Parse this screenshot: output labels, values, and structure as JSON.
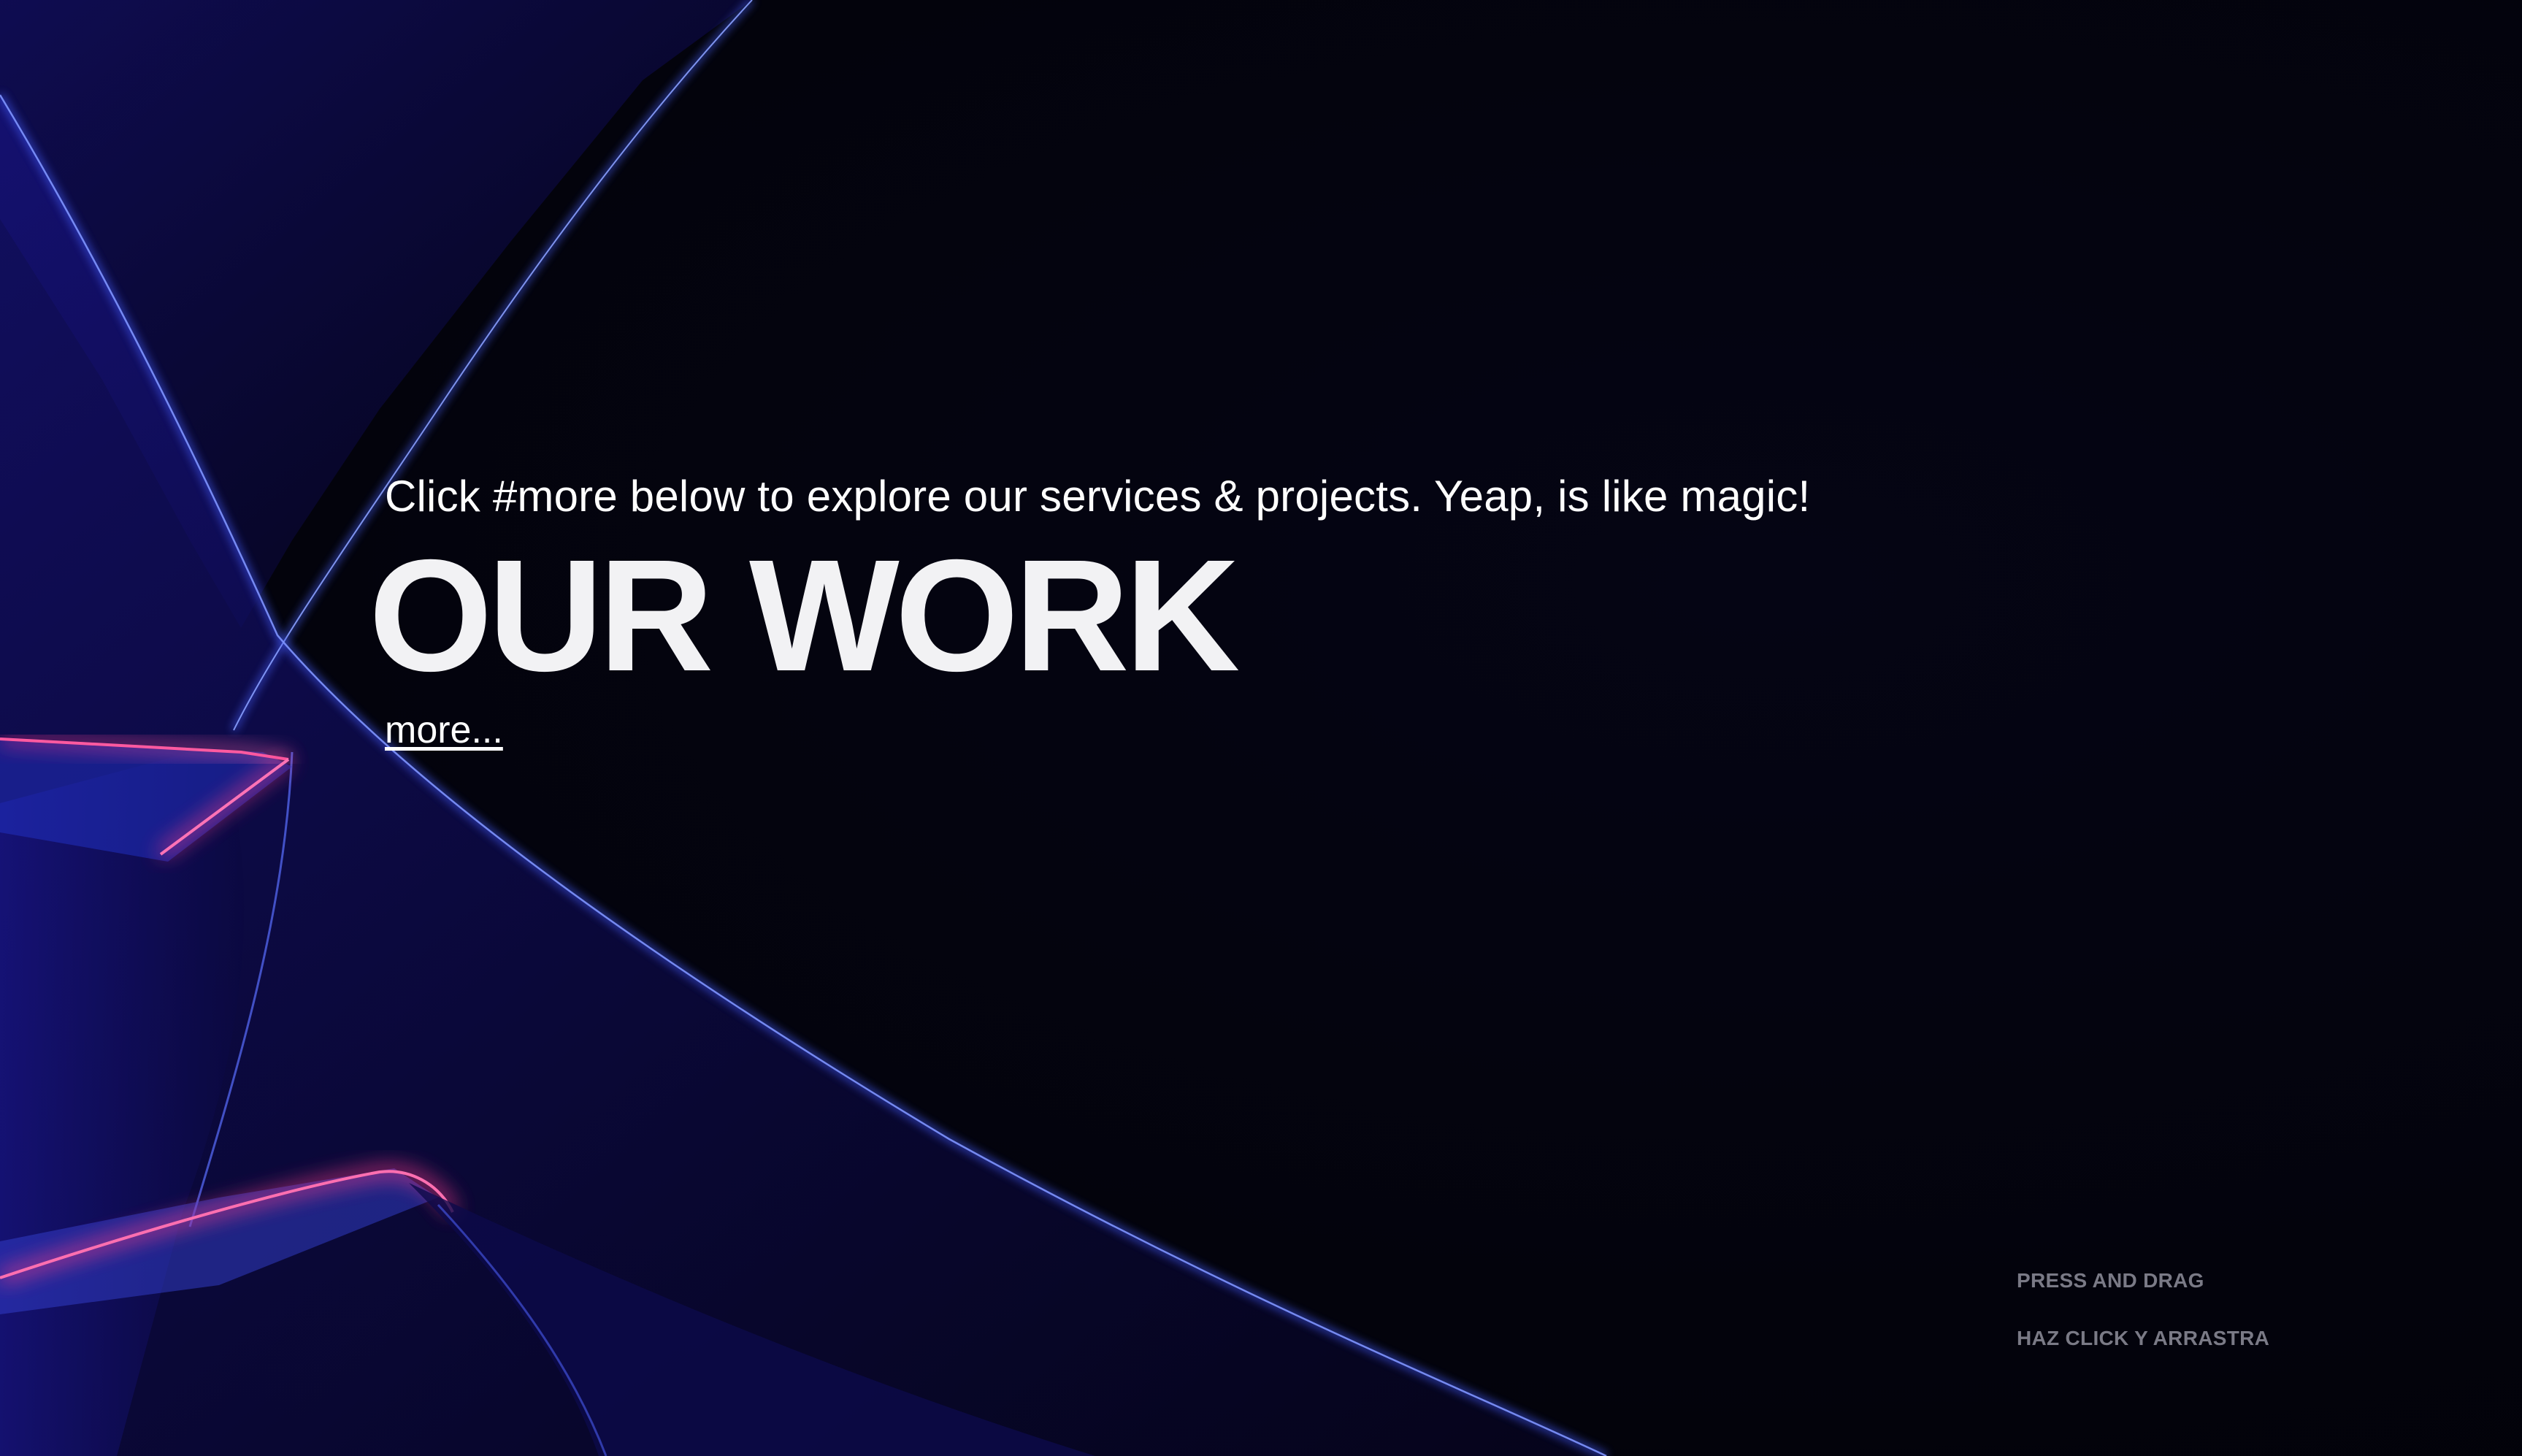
{
  "hero": {
    "intro_text": "Click #more below to explore our services & projects. Yeap, is like magic!",
    "title": "OUR WORK",
    "more_link": "more..."
  },
  "hints": {
    "press_and_drag_en": "PRESS AND DRAG",
    "press_and_drag_es": "HAZ CLICK Y ARRASTRA"
  },
  "colors": {
    "background": "#03030f",
    "ribbon_blue": "#3a4fd8",
    "ribbon_pink": "#ff3d8a",
    "text": "#ffffff",
    "hint_text": "#7a7a86"
  }
}
